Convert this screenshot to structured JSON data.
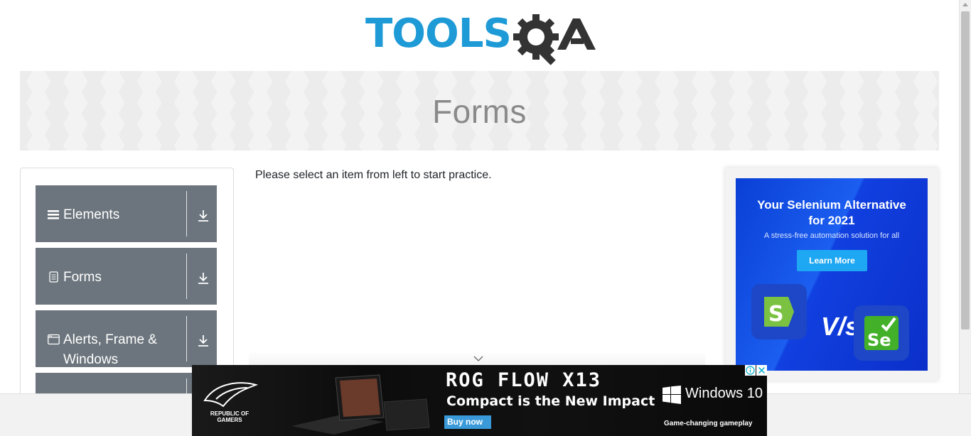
{
  "header": {
    "logo_text": "TOOLSQA"
  },
  "banner": {
    "title": "Forms"
  },
  "sidebar": {
    "groups": [
      {
        "label": "Elements",
        "icon": "hamburger-icon"
      },
      {
        "label": "Forms",
        "icon": "document-icon"
      },
      {
        "label": "Alerts, Frame & Windows",
        "icon": "window-icon"
      },
      {
        "label": "",
        "icon": ""
      }
    ]
  },
  "main": {
    "message": "Please select an item from left to start practice."
  },
  "right_ad": {
    "headline": "Your Selenium Alternative for 2021",
    "subline": "A stress-free automation solution for all",
    "button": "Learn More",
    "vs": "V/s"
  },
  "bottom_ad": {
    "brand": "REPUBLIC OF GAMERS",
    "title": "ROG FLOW X13",
    "subtitle": "Compact is the New Impact",
    "button": "Buy now",
    "windows": "Windows 10",
    "tagline": "Game-changing gameplay"
  },
  "colors": {
    "sidebar_bg": "#6c757d",
    "logo_blue": "#1e9ad6",
    "logo_dark": "#333333",
    "ad_blue": "#1140e0"
  }
}
